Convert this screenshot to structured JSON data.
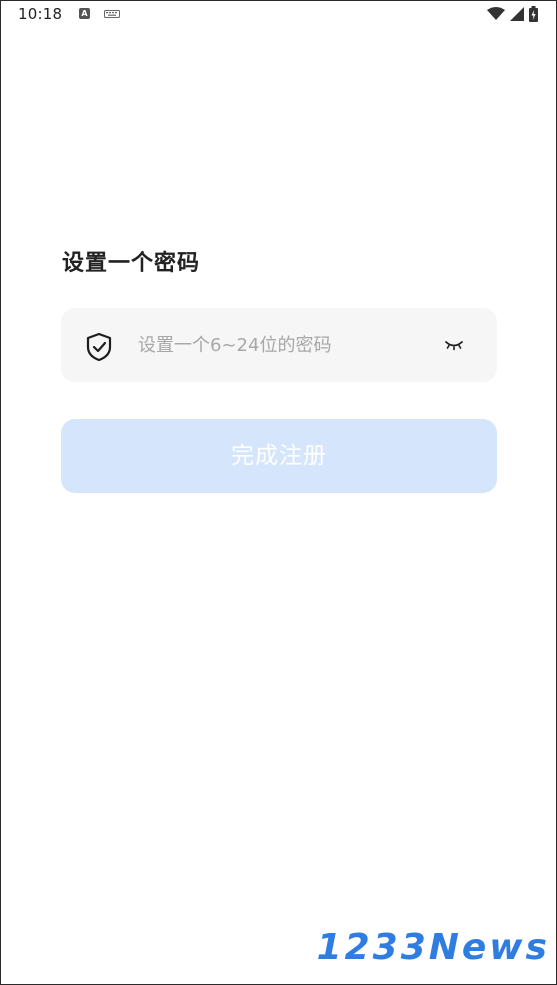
{
  "status_bar": {
    "time": "10:18",
    "a_badge": "A",
    "icons": [
      "notification-a-icon",
      "keyboard-icon",
      "wifi-icon",
      "signal-icon",
      "battery-icon"
    ]
  },
  "title": "设置一个密码",
  "password": {
    "value": "",
    "placeholder": "设置一个6~24位的密码",
    "leading_icon": "shield-check-icon",
    "trailing_icon": "eye-closed-icon"
  },
  "submit_button": {
    "label": "完成注册",
    "state": "disabled",
    "background": "#d5e6fc",
    "text_color": "#ffffff"
  },
  "watermark": "1233News",
  "colors": {
    "field_background": "#f6f6f6",
    "accent": "#2f7de1"
  }
}
